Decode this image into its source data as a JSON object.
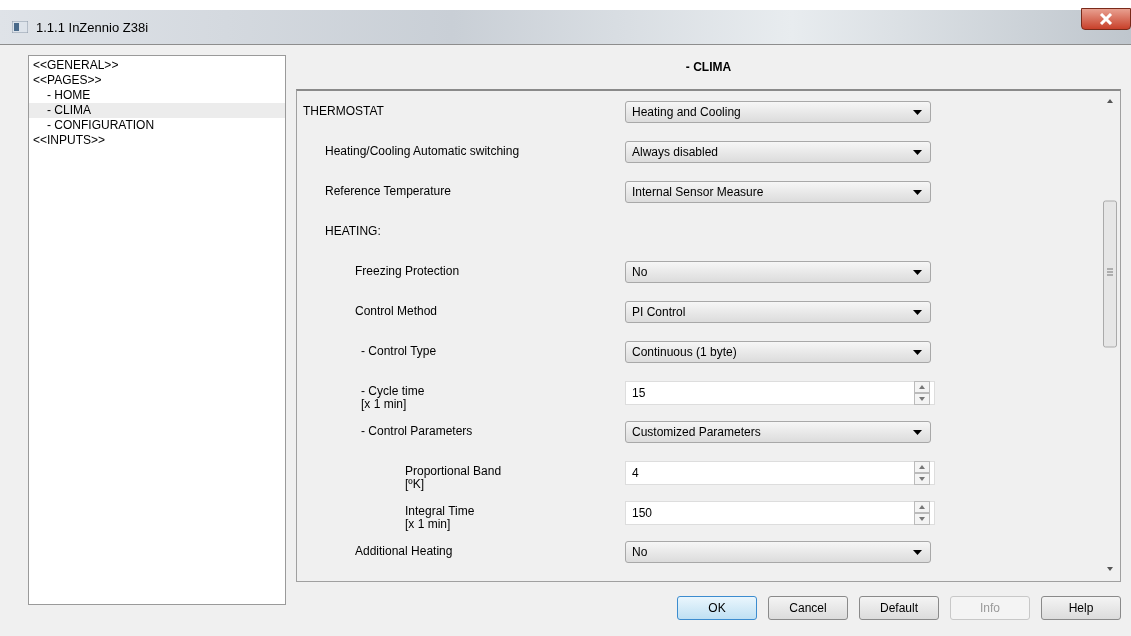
{
  "window": {
    "title": "1.1.1 InZennio Z38i"
  },
  "sidebar": {
    "items": [
      {
        "label": "<<GENERAL>>",
        "selected": false
      },
      {
        "label": "<<PAGES>>",
        "selected": false,
        "children": [
          {
            "label": "- HOME",
            "selected": false
          },
          {
            "label": "- CLIMA",
            "selected": true
          },
          {
            "label": "- CONFIGURATION",
            "selected": false
          }
        ]
      },
      {
        "label": "<<INPUTS>>",
        "selected": false
      }
    ]
  },
  "page": {
    "title": "- CLIMA",
    "parameters": [
      {
        "label": "THERMOSTAT",
        "kind": "dropdown",
        "value": "Heating and Cooling",
        "children": [
          {
            "label": "Heating/Cooling Automatic switching",
            "kind": "dropdown",
            "value": "Always disabled"
          },
          {
            "label": "Reference Temperature",
            "kind": "dropdown",
            "value": "Internal Sensor Measure"
          },
          {
            "label": "HEATING:",
            "kind": "heading",
            "children": [
              {
                "label": "Freezing Protection",
                "kind": "dropdown",
                "value": "No"
              },
              {
                "label": "Control Method",
                "kind": "dropdown",
                "value": "PI Control",
                "children": [
                  {
                    "label": "- Control Type",
                    "kind": "dropdown",
                    "value": "Continuous (1 byte)"
                  },
                  {
                    "label": "- Cycle time",
                    "unit": "[x 1 min]",
                    "kind": "spinner",
                    "value": "15"
                  },
                  {
                    "label": "- Control Parameters",
                    "kind": "dropdown",
                    "value": "Customized Parameters",
                    "children": [
                      {
                        "label": "Proportional Band",
                        "unit": "[ºK]",
                        "kind": "spinner",
                        "value": "4"
                      },
                      {
                        "label": "Integral Time",
                        "unit": "[x 1 min]",
                        "kind": "spinner",
                        "value": "150"
                      }
                    ]
                  }
                ]
              },
              {
                "label": "Additional Heating",
                "kind": "dropdown",
                "value": "No"
              }
            ]
          }
        ]
      }
    ]
  },
  "buttons": [
    {
      "label": "OK",
      "disabled": false,
      "selected": true
    },
    {
      "label": "Cancel",
      "disabled": false,
      "selected": false
    },
    {
      "label": "Default",
      "disabled": false,
      "selected": false
    },
    {
      "label": "Info",
      "disabled": true,
      "selected": false
    },
    {
      "label": "Help",
      "disabled": false,
      "selected": false
    }
  ]
}
